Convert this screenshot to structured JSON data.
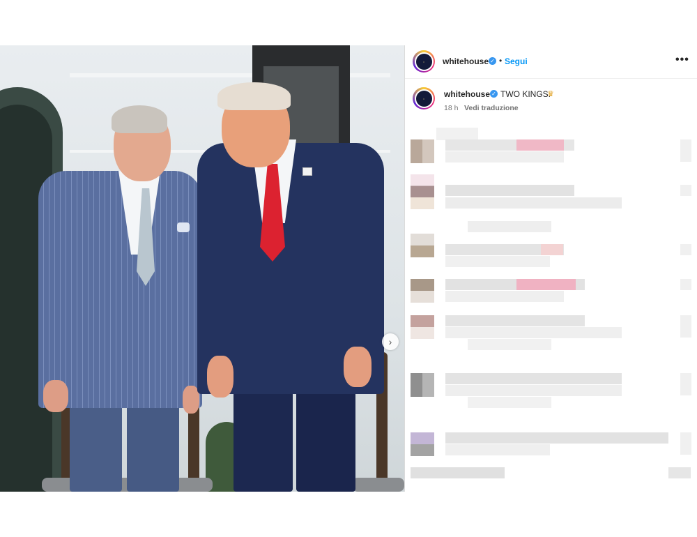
{
  "post": {
    "username": "whitehouse",
    "separator": "•",
    "follow_label": "Segui",
    "more_icon": "more-options-icon",
    "caption_username": "whitehouse",
    "caption_text": "TWO KINGS.",
    "caption_emoji": "♛",
    "time_ago": "18 h",
    "translate_label": "Vedi traduzione",
    "verified_glyph": "✓",
    "next_glyph": "›"
  },
  "colors": {
    "link_blue": "#0095f6",
    "verified_blue": "#3897f0"
  }
}
